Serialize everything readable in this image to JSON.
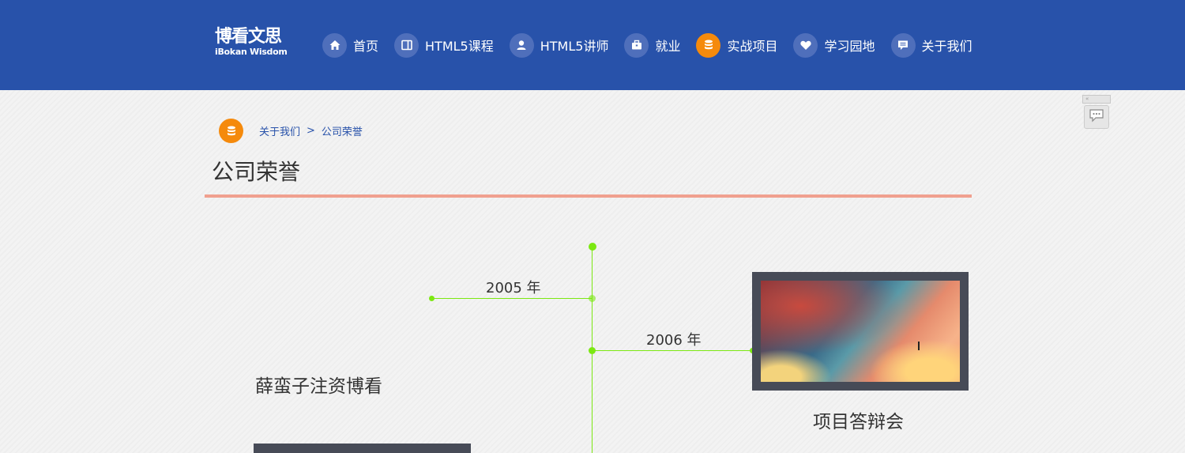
{
  "header": {
    "logo_cn": "博看文思",
    "logo_en": "iBokan Wisdom",
    "nav": [
      {
        "label": "首页",
        "icon": "home-icon"
      },
      {
        "label": "HTML5课程",
        "icon": "book-icon"
      },
      {
        "label": "HTML5讲师",
        "icon": "user-icon"
      },
      {
        "label": "就业",
        "icon": "briefcase-icon"
      },
      {
        "label": "实战项目",
        "icon": "database-icon",
        "active": true
      },
      {
        "label": "学习园地",
        "icon": "heart-icon"
      },
      {
        "label": "关于我们",
        "icon": "message-icon"
      }
    ],
    "accent": "#f58a0c",
    "bg": "#2852aa"
  },
  "breadcrumb": {
    "parent": "关于我们",
    "separator": ">",
    "current": "公司荣誉"
  },
  "page": {
    "title": "公司荣誉"
  },
  "timeline": {
    "line_color": "#7ce812",
    "events": [
      {
        "year": "2005 年",
        "caption": "薛蛮子注资博看"
      },
      {
        "year": "2006 年",
        "caption": "项目答辩会"
      }
    ]
  }
}
